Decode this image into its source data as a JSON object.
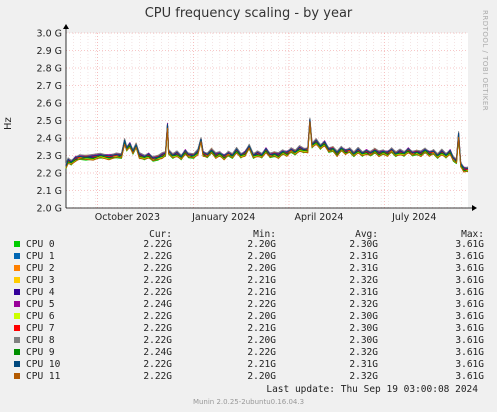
{
  "title": "CPU frequency scaling - by year",
  "side_label": "RRDTOOL / TOBI OETIKER",
  "footer": {
    "last_update_label": "Last update:",
    "last_update_value": "Thu Sep 19 03:00:08 2024",
    "version": "Munin 2.0.25-2ubuntu0.16.04.3"
  },
  "legend": {
    "headers": {
      "cur": "Cur:",
      "min": "Min:",
      "avg": "Avg:",
      "max": "Max:"
    },
    "rows": [
      {
        "name": "CPU 0",
        "color": "#00cc00",
        "cur": "2.22G",
        "min": "2.20G",
        "avg": "2.30G",
        "max": "3.61G"
      },
      {
        "name": "CPU 1",
        "color": "#0066b3",
        "cur": "2.22G",
        "min": "2.20G",
        "avg": "2.31G",
        "max": "3.61G"
      },
      {
        "name": "CPU 2",
        "color": "#ff8000",
        "cur": "2.22G",
        "min": "2.20G",
        "avg": "2.31G",
        "max": "3.61G"
      },
      {
        "name": "CPU 3",
        "color": "#ffcc00",
        "cur": "2.22G",
        "min": "2.21G",
        "avg": "2.32G",
        "max": "3.61G"
      },
      {
        "name": "CPU 4",
        "color": "#330099",
        "cur": "2.22G",
        "min": "2.21G",
        "avg": "2.31G",
        "max": "3.61G"
      },
      {
        "name": "CPU 5",
        "color": "#990099",
        "cur": "2.24G",
        "min": "2.22G",
        "avg": "2.32G",
        "max": "3.61G"
      },
      {
        "name": "CPU 6",
        "color": "#ccff00",
        "cur": "2.22G",
        "min": "2.20G",
        "avg": "2.30G",
        "max": "3.61G"
      },
      {
        "name": "CPU 7",
        "color": "#ff0000",
        "cur": "2.22G",
        "min": "2.21G",
        "avg": "2.30G",
        "max": "3.61G"
      },
      {
        "name": "CPU 8",
        "color": "#808080",
        "cur": "2.22G",
        "min": "2.20G",
        "avg": "2.30G",
        "max": "3.61G"
      },
      {
        "name": "CPU 9",
        "color": "#008f00",
        "cur": "2.24G",
        "min": "2.22G",
        "avg": "2.32G",
        "max": "3.61G"
      },
      {
        "name": "CPU 10",
        "color": "#00487d",
        "cur": "2.22G",
        "min": "2.21G",
        "avg": "2.31G",
        "max": "3.61G"
      },
      {
        "name": "CPU 11",
        "color": "#b35a00",
        "cur": "2.22G",
        "min": "2.20G",
        "avg": "2.32G",
        "max": "3.61G"
      }
    ]
  },
  "chart_data": {
    "type": "line",
    "title": "CPU frequency scaling - by year",
    "ylabel": "Hz",
    "ylim": [
      2.0,
      3.0
    ],
    "yticks": [
      2.0,
      2.1,
      2.2,
      2.3,
      2.4,
      2.5,
      2.6,
      2.7,
      2.8,
      2.9,
      3.0
    ],
    "ytick_labels": [
      "2.0 G",
      "2.1 G",
      "2.2 G",
      "2.3 G",
      "2.4 G",
      "2.5 G",
      "2.6 G",
      "2.7 G",
      "2.8 G",
      "2.9 G",
      "3.0 G"
    ],
    "xlim": [
      "2023-09-01",
      "2024-09-19"
    ],
    "xticks": [
      "2023-10-01",
      "2024-01-01",
      "2024-04-01",
      "2024-07-01"
    ],
    "xtick_labels": [
      "October 2023",
      "January 2024",
      "April 2024",
      "July 2024"
    ],
    "grid": true,
    "aggregate_trace_ghz": [
      [
        "2023-09-01",
        2.24
      ],
      [
        "2023-09-03",
        2.27
      ],
      [
        "2023-09-06",
        2.26
      ],
      [
        "2023-09-10",
        2.28
      ],
      [
        "2023-09-14",
        2.29
      ],
      [
        "2023-09-20",
        2.29
      ],
      [
        "2023-09-27",
        2.29
      ],
      [
        "2023-10-04",
        2.3
      ],
      [
        "2023-10-12",
        2.29
      ],
      [
        "2023-10-19",
        2.3
      ],
      [
        "2023-10-24",
        2.3
      ],
      [
        "2023-10-27",
        2.38
      ],
      [
        "2023-10-29",
        2.34
      ],
      [
        "2023-11-01",
        2.36
      ],
      [
        "2023-11-04",
        2.32
      ],
      [
        "2023-11-07",
        2.36
      ],
      [
        "2023-11-10",
        2.3
      ],
      [
        "2023-11-15",
        2.29
      ],
      [
        "2023-11-19",
        2.3
      ],
      [
        "2023-11-23",
        2.28
      ],
      [
        "2023-11-28",
        2.29
      ],
      [
        "2023-12-02",
        2.3
      ],
      [
        "2023-12-05",
        2.31
      ],
      [
        "2023-12-07",
        2.47
      ],
      [
        "2023-12-08",
        2.32
      ],
      [
        "2023-12-12",
        2.3
      ],
      [
        "2023-12-16",
        2.31
      ],
      [
        "2023-12-20",
        2.29
      ],
      [
        "2023-12-24",
        2.32
      ],
      [
        "2023-12-27",
        2.3
      ],
      [
        "2024-01-01",
        2.3
      ],
      [
        "2024-01-05",
        2.32
      ],
      [
        "2024-01-08",
        2.39
      ],
      [
        "2024-01-10",
        2.31
      ],
      [
        "2024-01-14",
        2.3
      ],
      [
        "2024-01-18",
        2.33
      ],
      [
        "2024-01-22",
        2.3
      ],
      [
        "2024-01-26",
        2.31
      ],
      [
        "2024-01-30",
        2.29
      ],
      [
        "2024-02-03",
        2.31
      ],
      [
        "2024-02-07",
        2.3
      ],
      [
        "2024-02-11",
        2.33
      ],
      [
        "2024-02-15",
        2.3
      ],
      [
        "2024-02-19",
        2.31
      ],
      [
        "2024-02-23",
        2.35
      ],
      [
        "2024-02-27",
        2.3
      ],
      [
        "2024-03-02",
        2.31
      ],
      [
        "2024-03-06",
        2.3
      ],
      [
        "2024-03-10",
        2.33
      ],
      [
        "2024-03-14",
        2.3
      ],
      [
        "2024-03-18",
        2.31
      ],
      [
        "2024-03-22",
        2.3
      ],
      [
        "2024-03-26",
        2.32
      ],
      [
        "2024-03-30",
        2.31
      ],
      [
        "2024-04-03",
        2.33
      ],
      [
        "2024-04-07",
        2.32
      ],
      [
        "2024-04-11",
        2.34
      ],
      [
        "2024-04-15",
        2.33
      ],
      [
        "2024-04-19",
        2.33
      ],
      [
        "2024-04-21",
        2.5
      ],
      [
        "2024-04-23",
        2.36
      ],
      [
        "2024-04-27",
        2.38
      ],
      [
        "2024-05-01",
        2.35
      ],
      [
        "2024-05-05",
        2.37
      ],
      [
        "2024-05-09",
        2.33
      ],
      [
        "2024-05-13",
        2.34
      ],
      [
        "2024-05-17",
        2.31
      ],
      [
        "2024-05-21",
        2.34
      ],
      [
        "2024-05-25",
        2.32
      ],
      [
        "2024-05-29",
        2.33
      ],
      [
        "2024-06-02",
        2.31
      ],
      [
        "2024-06-06",
        2.33
      ],
      [
        "2024-06-10",
        2.31
      ],
      [
        "2024-06-14",
        2.32
      ],
      [
        "2024-06-18",
        2.31
      ],
      [
        "2024-06-22",
        2.33
      ],
      [
        "2024-06-26",
        2.31
      ],
      [
        "2024-06-30",
        2.32
      ],
      [
        "2024-07-04",
        2.31
      ],
      [
        "2024-07-08",
        2.33
      ],
      [
        "2024-07-12",
        2.31
      ],
      [
        "2024-07-16",
        2.32
      ],
      [
        "2024-07-20",
        2.31
      ],
      [
        "2024-07-24",
        2.33
      ],
      [
        "2024-07-28",
        2.31
      ],
      [
        "2024-08-01",
        2.32
      ],
      [
        "2024-08-05",
        2.31
      ],
      [
        "2024-08-09",
        2.33
      ],
      [
        "2024-08-13",
        2.31
      ],
      [
        "2024-08-17",
        2.32
      ],
      [
        "2024-08-21",
        2.3
      ],
      [
        "2024-08-25",
        2.32
      ],
      [
        "2024-08-29",
        2.3
      ],
      [
        "2024-09-02",
        2.32
      ],
      [
        "2024-09-05",
        2.28
      ],
      [
        "2024-09-08",
        2.27
      ],
      [
        "2024-09-10",
        2.42
      ],
      [
        "2024-09-12",
        2.25
      ],
      [
        "2024-09-15",
        2.22
      ],
      [
        "2024-09-19",
        2.22
      ]
    ],
    "series": [
      {
        "name": "CPU 0"
      },
      {
        "name": "CPU 1"
      },
      {
        "name": "CPU 2"
      },
      {
        "name": "CPU 3"
      },
      {
        "name": "CPU 4"
      },
      {
        "name": "CPU 5"
      },
      {
        "name": "CPU 6"
      },
      {
        "name": "CPU 7"
      },
      {
        "name": "CPU 8"
      },
      {
        "name": "CPU 9"
      },
      {
        "name": "CPU 10"
      },
      {
        "name": "CPU 11"
      }
    ]
  }
}
